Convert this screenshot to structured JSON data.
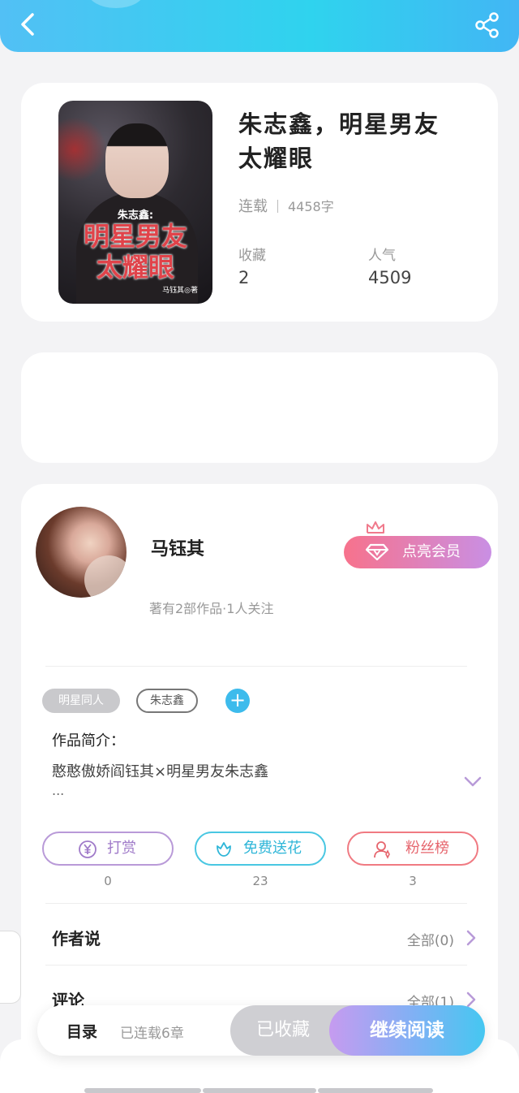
{
  "header": {
    "back_icon": "chevron-left-icon",
    "share_icon": "share-icon"
  },
  "book": {
    "cover_subtitle": "朱志鑫:",
    "cover_title_line1": "明星男友",
    "cover_title_line2": "太耀眼",
    "cover_author": "马钰其◎著",
    "title_line1": "朱志鑫，明星男友",
    "title_line2": "太耀眼",
    "status": "连载",
    "word_count": "4458字",
    "favorites_label": "收藏",
    "favorites_value": "2",
    "popularity_label": "人气",
    "popularity_value": "4509"
  },
  "author": {
    "name": "马钰其",
    "stats": "著有2部作品·1人关注",
    "vip_label": "点亮会员",
    "tags": [
      "明星同人",
      "朱志鑫"
    ],
    "add_tag": "+",
    "intro_title": "作品简介：",
    "intro_text": "憨憨傲娇阎钰其×明星男友朱志鑫",
    "intro_more": "..."
  },
  "actions": [
    {
      "label": "打赏",
      "count": "0",
      "icon": "yen-coin-icon"
    },
    {
      "label": "免费送花",
      "count": "23",
      "icon": "flower-icon"
    },
    {
      "label": "粉丝榜",
      "count": "3",
      "icon": "fans-user-icon"
    }
  ],
  "sections": {
    "author_says": {
      "title": "作者说",
      "link": "全部(0)"
    },
    "comments": {
      "title": "评论",
      "link": "全部(1)"
    }
  },
  "bottom_bar": {
    "toc_label": "目录",
    "toc_status": "已连载6章",
    "collected_label": "已收藏",
    "read_label": "继续阅读"
  },
  "colors": {
    "header_gradient_start": "#52c0f5",
    "header_gradient_end": "#42b6f4",
    "vip_gradient_start": "#f7728c",
    "vip_gradient_end": "#c98fe4",
    "read_gradient_start": "#c69bf0",
    "read_gradient_end": "#45c7f1",
    "accent_blue": "#3dbbec"
  }
}
